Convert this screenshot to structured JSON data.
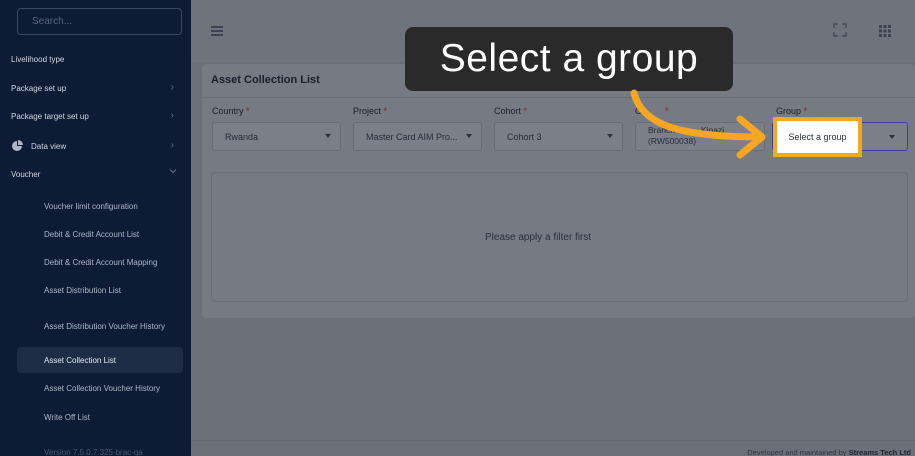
{
  "sidebar": {
    "search_placeholder": "Search...",
    "items": [
      {
        "label": "Livelihood type"
      },
      {
        "label": "Package set up"
      },
      {
        "label": "Package target set up"
      },
      {
        "label": "Data view"
      },
      {
        "label": "Voucher"
      }
    ],
    "voucher_sub": [
      {
        "label": "Voucher limit configuration"
      },
      {
        "label": "Debit & Credit Account List"
      },
      {
        "label": "Debit & Credit Account Mapping"
      },
      {
        "label": "Asset Distribution List"
      },
      {
        "label": "Asset Distribution Voucher History"
      },
      {
        "label": "Asset Collection List"
      },
      {
        "label": "Asset Collection Voucher History"
      },
      {
        "label": "Write Off List"
      }
    ],
    "version": "Version 7.5.0.7.325-brac-qa"
  },
  "page": {
    "title": "Asset Collection List",
    "empty_message": "Please apply a filter first"
  },
  "filters": {
    "country": {
      "label": "Country",
      "value": "Rwanda"
    },
    "project": {
      "label": "Project",
      "value": "Master Card AIM Pro..."
    },
    "cohort": {
      "label": "Cohort",
      "value": "Cohort 3"
    },
    "office": {
      "label": "Of",
      "value_line1": "Branch",
      "value_tail": "Kinazi",
      "value_line2": "(RW500038)"
    },
    "group": {
      "label": "Group",
      "placeholder": "Select a group"
    },
    "required_mark": "*"
  },
  "tooltip": {
    "text": "Select a group"
  },
  "footer": {
    "prefix": "Developed and maintained by",
    "company": "Streams Tech Ltd"
  },
  "colors": {
    "highlight": "#f5a623",
    "sidebar": "#0d1b34",
    "tooltip": "#2a2a2a"
  }
}
